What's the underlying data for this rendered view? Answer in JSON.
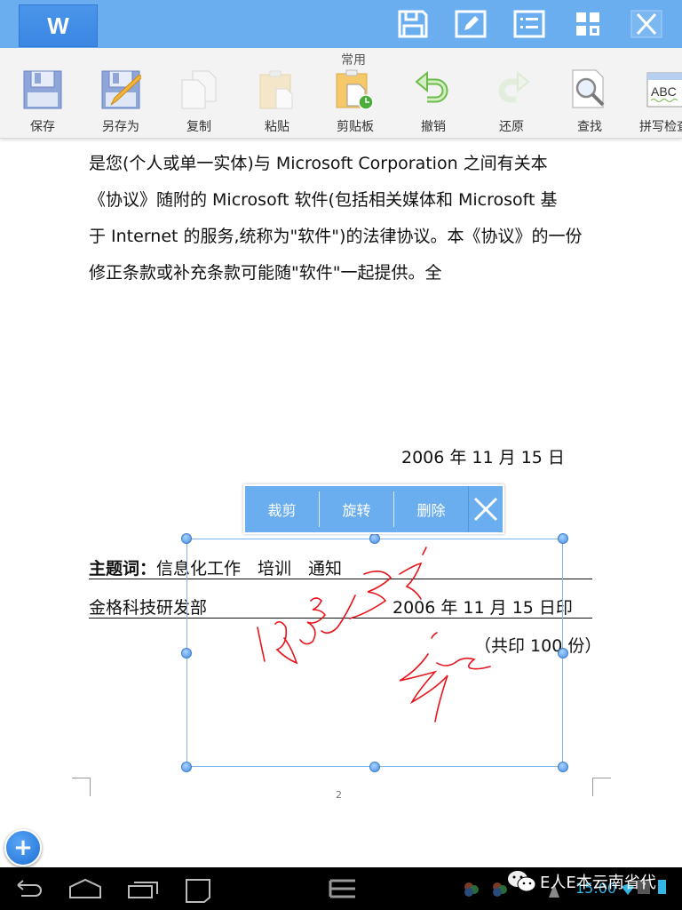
{
  "topbar": {
    "logo_letter": "W",
    "icons": [
      "save-icon",
      "edit-icon",
      "list-icon",
      "grid-icon",
      "close-icon"
    ]
  },
  "ribbon": {
    "group_label": "常用",
    "tools": [
      {
        "label": "保存",
        "icon": "save-icon",
        "enabled": true
      },
      {
        "label": "另存为",
        "icon": "save-as-icon",
        "enabled": true
      },
      {
        "label": "复制",
        "icon": "copy-icon",
        "enabled": false
      },
      {
        "label": "粘贴",
        "icon": "paste-icon",
        "enabled": false
      },
      {
        "label": "剪贴板",
        "icon": "clipboard-icon",
        "enabled": true
      },
      {
        "label": "撤销",
        "icon": "undo-icon",
        "enabled": true
      },
      {
        "label": "还原",
        "icon": "redo-icon",
        "enabled": false
      },
      {
        "label": "查找",
        "icon": "find-icon",
        "enabled": true
      },
      {
        "label": "拼写检查",
        "icon": "spellcheck-icon",
        "enabled": true
      }
    ]
  },
  "document": {
    "paragraph_lines": [
      "是您(个人或单一实体)与 Microsoft Corporation 之间有关本",
      "《协议》随附的 Microsoft 软件(包括相关媒体和 Microsoft 基",
      "于 Internet 的服务,统称为\"软件\")的法律协议。本《协议》的一份",
      "修正条款或补充条款可能随\"软件\"一起提供。全"
    ],
    "date": "2006 年 11 月 15 日",
    "subject_label": "主题词：",
    "subject_value": "信息化工作　培训　通知",
    "department": "金格科技研发部",
    "print_date": "2006 年 11 月 15 日印",
    "copies": "（共印 100 份）",
    "page_number": "2"
  },
  "context_menu": {
    "items": [
      "裁剪",
      "旋转",
      "删除"
    ],
    "close_icon": "close-icon"
  },
  "fab": {
    "label": "+"
  },
  "navbar": {
    "clock": "15:00",
    "watermark": "E人E本云南省代"
  }
}
